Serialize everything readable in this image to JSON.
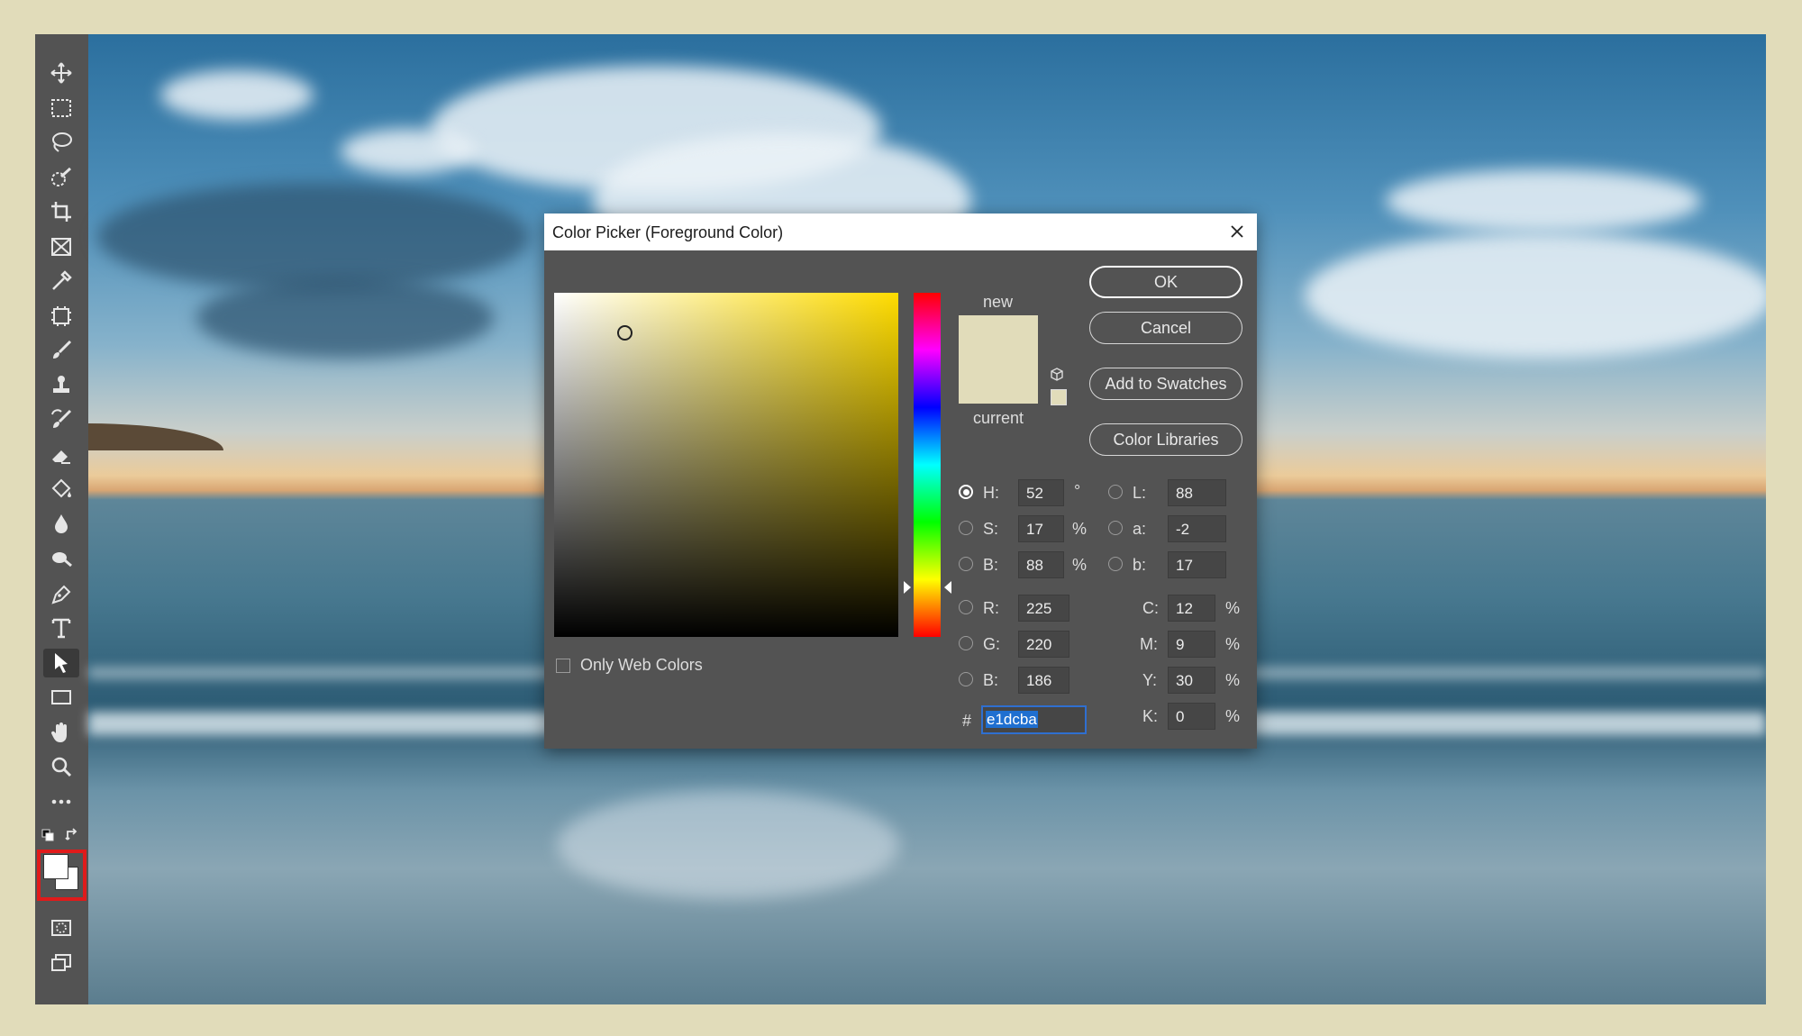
{
  "toolbar": {
    "tools": [
      {
        "name": "move-tool",
        "icon": "move-icon"
      },
      {
        "name": "marquee-tool",
        "icon": "rectangular-marquee-icon"
      },
      {
        "name": "lasso-tool",
        "icon": "lasso-icon"
      },
      {
        "name": "quick-selection-tool",
        "icon": "quick-selection-icon"
      },
      {
        "name": "crop-tool",
        "icon": "crop-icon"
      },
      {
        "name": "frame-tool",
        "icon": "frame-icon"
      },
      {
        "name": "eyedropper-tool",
        "icon": "eyedropper-icon"
      },
      {
        "name": "healing-tool",
        "icon": "spot-healing-icon"
      },
      {
        "name": "brush-tool",
        "icon": "brush-icon"
      },
      {
        "name": "stamp-tool",
        "icon": "clone-stamp-icon"
      },
      {
        "name": "history-brush-tool",
        "icon": "history-brush-icon"
      },
      {
        "name": "eraser-tool",
        "icon": "eraser-icon"
      },
      {
        "name": "paint-bucket-tool",
        "icon": "paint-bucket-icon"
      },
      {
        "name": "blur-tool",
        "icon": "blur-icon"
      },
      {
        "name": "dodge-tool",
        "icon": "dodge-icon"
      },
      {
        "name": "pen-tool",
        "icon": "pen-icon"
      },
      {
        "name": "type-tool",
        "icon": "type-icon"
      },
      {
        "name": "path-selection-tool",
        "icon": "path-selection-icon"
      },
      {
        "name": "rectangle-tool",
        "icon": "rectangle-icon"
      },
      {
        "name": "hand-tool",
        "icon": "hand-icon"
      },
      {
        "name": "zoom-tool",
        "icon": "zoom-icon"
      },
      {
        "name": "more-tools",
        "icon": "more-icon"
      }
    ],
    "foreground_color": "#ffffff",
    "background_color": "#ffffff",
    "highlight_color": "#e01b1b"
  },
  "dialog": {
    "title": "Color Picker (Foreground Color)",
    "new_label": "new",
    "current_label": "current",
    "new_color": "#e1dcba",
    "current_color": "#e1dcba",
    "buttons": {
      "ok": "OK",
      "cancel": "Cancel",
      "add_swatches": "Add to Swatches",
      "color_libraries": "Color Libraries"
    },
    "only_web_colors": "Only Web Colors",
    "fields": {
      "h": {
        "label": "H:",
        "value": "52",
        "unit": "°"
      },
      "s": {
        "label": "S:",
        "value": "17",
        "unit": "%"
      },
      "b": {
        "label": "B:",
        "value": "88",
        "unit": "%"
      },
      "r": {
        "label": "R:",
        "value": "225"
      },
      "g": {
        "label": "G:",
        "value": "220"
      },
      "bl": {
        "label": "B:",
        "value": "186"
      },
      "l": {
        "label": "L:",
        "value": "88"
      },
      "a": {
        "label": "a:",
        "value": "-2"
      },
      "lb": {
        "label": "b:",
        "value": "17"
      },
      "c": {
        "label": "C:",
        "value": "12",
        "unit": "%"
      },
      "m": {
        "label": "M:",
        "value": "9",
        "unit": "%"
      },
      "y": {
        "label": "Y:",
        "value": "30",
        "unit": "%"
      },
      "k": {
        "label": "K:",
        "value": "0",
        "unit": "%"
      }
    },
    "hex_prefix": "#",
    "hex_value": "e1dcba",
    "hue_degrees": 52
  }
}
